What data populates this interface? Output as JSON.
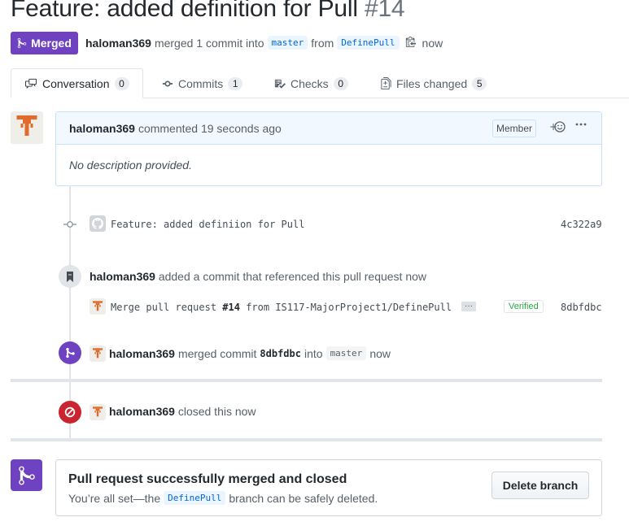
{
  "pr": {
    "title": "Feature: added definition for Pull",
    "number": "#14",
    "state_label": "Merged",
    "author": "haloman369",
    "merge_summary": "merged 1 commit into",
    "base_branch": "master",
    "from_word": "from",
    "head_branch": "DefinePull",
    "time": "now"
  },
  "tabs": [
    {
      "label": "Conversation",
      "count": "0",
      "icon": "comment-discussion-icon"
    },
    {
      "label": "Commits",
      "count": "1",
      "icon": "git-commit-icon"
    },
    {
      "label": "Checks",
      "count": "0",
      "icon": "checklist-icon"
    },
    {
      "label": "Files changed",
      "count": "5",
      "icon": "file-diff-icon"
    }
  ],
  "comment": {
    "author": "haloman369",
    "action": "commented 19 seconds ago",
    "role_label": "Member",
    "body": "No description provided."
  },
  "timeline": {
    "commit1": {
      "message": "Feature: added definiion for Pull",
      "sha": "4c322a9"
    },
    "reference": {
      "author": "haloman369",
      "text": "added a commit that referenced this pull request now"
    },
    "commit2": {
      "msg_prefix": "Merge pull request",
      "msg_pr": "#14",
      "msg_suffix": "from IS117-MajorProject1/DefinePull",
      "verified": "Verified",
      "sha": "8dbfdbc",
      "ellipsis": "···"
    },
    "merged": {
      "author": "haloman369",
      "text": "merged commit",
      "sha": "8dbfdbc",
      "into": "into",
      "branch": "master",
      "time": "now"
    },
    "closed": {
      "author": "haloman369",
      "text": "closed this now"
    }
  },
  "merge_box": {
    "title": "Pull request successfully merged and closed",
    "sub_prefix": "You’re all set—the",
    "branch": "DefinePull",
    "sub_suffix": "branch can be safely deleted.",
    "delete_button": "Delete branch"
  },
  "colors": {
    "merged": "#6f42c1",
    "closed": "#cb2431",
    "link": "#0366d6",
    "verified": "#28a745"
  }
}
